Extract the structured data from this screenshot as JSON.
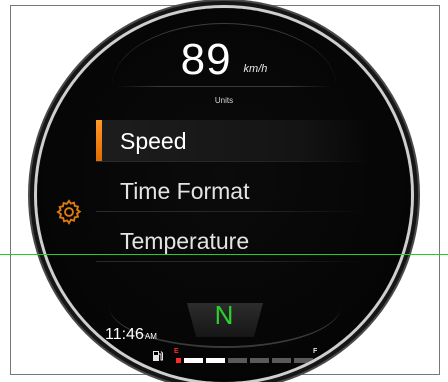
{
  "dashboard": {
    "speed": "89",
    "speed_unit": "km/h",
    "section_title": "Units",
    "menu": [
      {
        "label": "Speed",
        "selected": true
      },
      {
        "label": "Time Format",
        "selected": false
      },
      {
        "label": "Temperature",
        "selected": false
      }
    ],
    "gear": "N",
    "time": "11:46",
    "time_period": "AM",
    "fuel": {
      "empty_label": "E",
      "full_label": "F",
      "level_fraction": 0.375
    }
  },
  "colors": {
    "accent": "#e07a10",
    "gear": "#2bd22b",
    "fuel_low": "#ff2a2a",
    "overlay_line": "#27cc27"
  },
  "icons": {
    "settings": "gear-icon",
    "fuel": "fuel-pump-icon"
  }
}
